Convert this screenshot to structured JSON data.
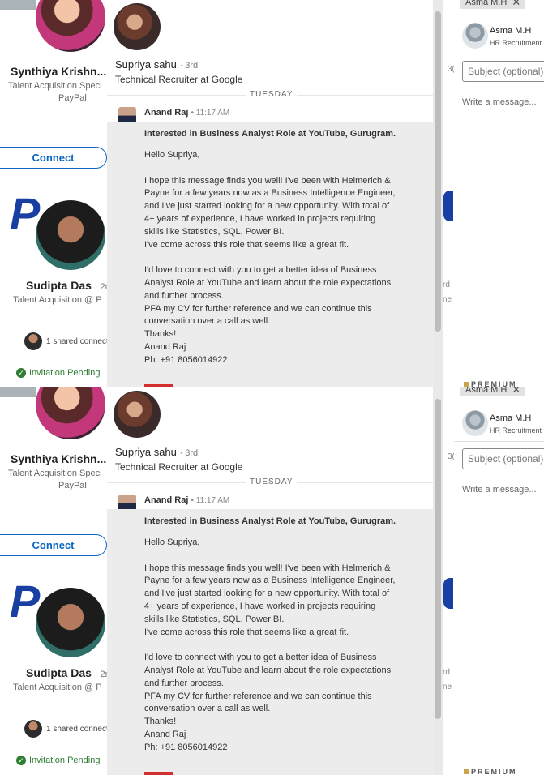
{
  "panels": [
    {
      "left_cards": {
        "card1": {
          "name": "Synthiya Krishn...",
          "title": "Talent Acquisition Speci",
          "company": "PayPal",
          "connect_label": "Connect"
        },
        "card2": {
          "name": "Sudipta Das",
          "degree": "· 2r",
          "title": "Talent Acquisition @ P",
          "shared": "1 shared connect",
          "pending": "Invitation Pending"
        }
      },
      "conversation": {
        "name": "Supriya sahu",
        "degree": "· 3rd",
        "title": "Technical Recruiter at Google",
        "day": "TUESDAY",
        "sender": "Anand Raj",
        "time": "• 11:17 AM",
        "subject": "Interested in Business Analyst Role at YouTube, Gurugram.",
        "body": "Hello Supriya,\n\nI hope this message finds you well! I've been with Helmerich & Payne for a few years now as a Business Intelligence Engineer, and I've just started looking for a new opportunity. With total of 4+ years of experience, I have worked in projects requiring skills like Statistics, SQL, Power BI.\nI've come across this role that seems like a great fit.\n\nI'd love to connect with you to get a better idea of Business Analyst Role at YouTube and learn about the role expectations and further process.\nPFA my CV for further reference and we can continue this conversation over a call as well.\nThanks!\nAnand Raj\nPh: +91 8056014922"
      },
      "strip": {
        "a": "3(",
        "b": "rd",
        "c": "ne"
      },
      "compose": {
        "chip_label": "Asma M.H",
        "recipient_name": "Asma M.H",
        "recipient_title": "HR Recruitment",
        "subject_placeholder": "Subject (optional)",
        "message_placeholder": "Write a message...",
        "premium": "PREMIUM"
      }
    },
    {
      "left_cards": {
        "card1": {
          "name": "Synthiya Krishn...",
          "title": "Talent Acquisition Speci",
          "company": "PayPal",
          "connect_label": "Connect"
        },
        "card2": {
          "name": "Sudipta Das",
          "degree": "· 2r",
          "title": "Talent Acquisition @ P",
          "shared": "1 shared connect",
          "pending": "Invitation Pending"
        }
      },
      "conversation": {
        "name": "Supriya sahu",
        "degree": "· 3rd",
        "title": "Technical Recruiter at Google",
        "day": "TUESDAY",
        "sender": "Anand Raj",
        "time": "• 11:17 AM",
        "subject": "Interested in Business Analyst Role at YouTube, Gurugram.",
        "body": "Hello Supriya,\n\nI hope this message finds you well! I've been with Helmerich & Payne for a few years now as a Business Intelligence Engineer, and I've just started looking for a new opportunity. With total of 4+ years of experience, I have worked in projects requiring skills like Statistics, SQL, Power BI.\nI've come across this role that seems like a great fit.\n\nI'd love to connect with you to get a better idea of Business Analyst Role at YouTube and learn about the role expectations and further process.\nPFA my CV for further reference and we can continue this conversation over a call as well.\nThanks!\nAnand Raj\nPh: +91 8056014922"
      },
      "strip": {
        "a": "3(",
        "b": "rd",
        "c": "ne"
      },
      "compose": {
        "chip_label": "Asma M.H",
        "recipient_name": "Asma M.H",
        "recipient_title": "HR Recruitment",
        "subject_placeholder": "Subject (optional)",
        "message_placeholder": "Write a message...",
        "premium": "PREMIUM"
      }
    }
  ],
  "colors": {
    "brand_blue": "#0a66c2",
    "pending_green": "#2e7d32",
    "paypal_blue": "#1a3fa3"
  }
}
